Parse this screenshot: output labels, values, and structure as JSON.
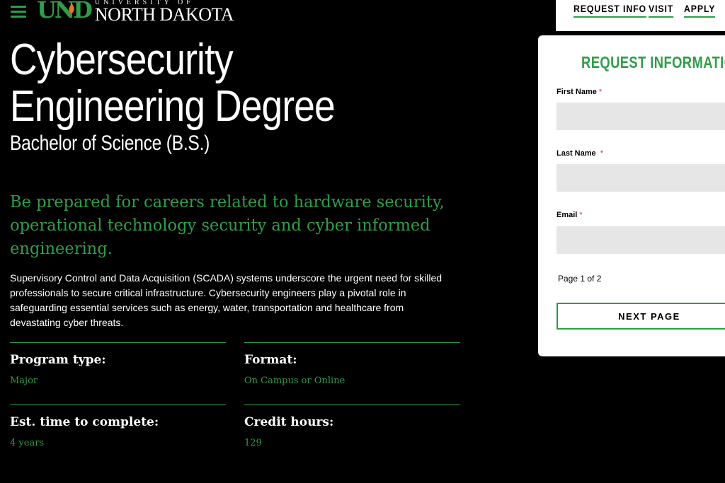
{
  "header": {
    "logo": {
      "mark": "UND",
      "line1": "UNIVERSITY OF",
      "line2": "NORTH DAKOTA"
    },
    "nav": [
      "REQUEST INFO",
      "VISIT",
      "APPLY"
    ]
  },
  "hero": {
    "title": "Cybersecurity Engineering Degree",
    "subtitle": "Bachelor of Science (B.S.)",
    "tagline": "Be prepared for careers related to hardware security, operational technology security and cyber informed engineering.",
    "description": "Supervisory Control and Data Acquisition (SCADA) systems underscore the urgent need for skilled professionals to secure critical infrastructure. Cybersecurity engineers play a pivotal role in safeguarding essential services such as energy, water, transportation and healthcare from devastating cyber threats."
  },
  "facts": [
    {
      "label": "Program type:",
      "value": "Major"
    },
    {
      "label": "Format:",
      "value": "On Campus or Online"
    },
    {
      "label": "Est. time to complete:",
      "value": "4 years"
    },
    {
      "label": "Credit hours:",
      "value": "129"
    }
  ],
  "form": {
    "title": "REQUEST INFORMATION",
    "fields": [
      {
        "label": "First Name",
        "required_mark": "*",
        "value": ""
      },
      {
        "label": "Last Name",
        "required_mark": "*",
        "value": ""
      },
      {
        "label": "Email",
        "required_mark": "*",
        "value": ""
      }
    ],
    "page_info": "Page 1 of 2",
    "next_label": "NEXT PAGE"
  },
  "colors": {
    "accent": "#2e9e48",
    "background": "#000000",
    "field_bg": "#e6e6e6",
    "required": "#c0392b"
  }
}
